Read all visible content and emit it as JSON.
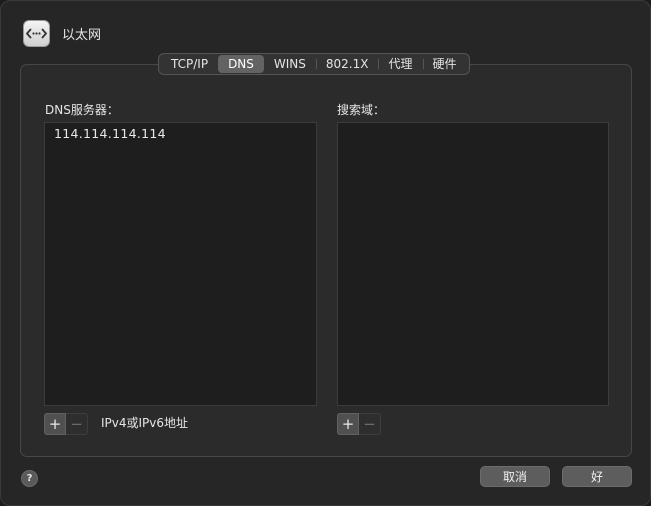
{
  "window": {
    "title": "以太网",
    "app_icon": "network-arrows-icon"
  },
  "tabs": [
    {
      "label": "TCP/IP",
      "active": false
    },
    {
      "label": "DNS",
      "active": true
    },
    {
      "label": "WINS",
      "active": false
    },
    {
      "label": "802.1X",
      "active": false
    },
    {
      "label": "代理",
      "active": false
    },
    {
      "label": "硬件",
      "active": false
    }
  ],
  "dns_servers": {
    "label": "DNS服务器：",
    "items": [
      "114.114.114.114"
    ],
    "add_symbol": "+",
    "remove_symbol": "−",
    "hint": "IPv4或IPv6地址"
  },
  "search_domains": {
    "label": "搜索域：",
    "items": [],
    "add_symbol": "+",
    "remove_symbol": "−"
  },
  "footer": {
    "help_symbol": "?",
    "cancel_label": "取消",
    "ok_label": "好"
  }
}
